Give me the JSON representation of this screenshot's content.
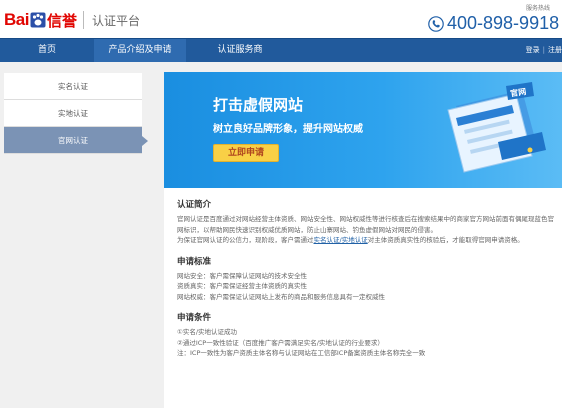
{
  "header": {
    "logo_bai": "Bai",
    "logo_xinyu": "信誉",
    "platform": "认证平台",
    "hotline_label": "服务热线",
    "hotline_number": "400-898-9918"
  },
  "nav": {
    "items": [
      {
        "label": "首页"
      },
      {
        "label": "产品介绍及申请"
      },
      {
        "label": "认证服务商"
      }
    ],
    "login": "登录",
    "register": "注册"
  },
  "sidebar": {
    "items": [
      {
        "label": "实名认证"
      },
      {
        "label": "实地认证"
      },
      {
        "label": "官网认证"
      }
    ]
  },
  "banner": {
    "title": "打击虚假网站",
    "subtitle": "树立良好品牌形象，提升网站权威",
    "button": "立即申请",
    "badge": "官网"
  },
  "content": {
    "intro_title": "认证简介",
    "intro_p1": "官网认证是百度通过对网站经营主体资质、网站安全性、网站权威性等进行核查后在搜索结果中的商家官方网站前面有偶尾现蓝色官网标识，以帮助网民快速识别权威优质网站，防止山寨网站、钓鱼虚假网站对网民的侵害。",
    "intro_p2_before": "为保证官网认证的公信力，现阶段，客户需通过",
    "intro_p2_link": "实名认证/实地认证",
    "intro_p2_after": "对主体资质真实性的核验后，才能取得官网申请资格。",
    "criteria_title": "申请标准",
    "criteria": [
      "网站安全：客户需保障认证网站的技术安全性",
      "资质真实：客户需保证经营主体资质的真实性",
      "网站权威：客户需保证认证网站上发布的商品和服务信息具有一定权威性"
    ],
    "conditions_title": "申请条件",
    "conditions": [
      "①实名/实地认证成功",
      "②通过ICP一致性验证（百度推广客户需满足实名/实地认证的行业要求）",
      "注：ICP一致性为客户资质主体名称与认证网站在工信部ICP备案资质主体名称完全一致"
    ]
  },
  "colors": {
    "nav_bg": "#215a9c",
    "brand_red": "#e10602",
    "banner_blue": "#1a8ee0",
    "button_yellow": "#f9d046",
    "sidebar_active": "#7b93b5"
  }
}
